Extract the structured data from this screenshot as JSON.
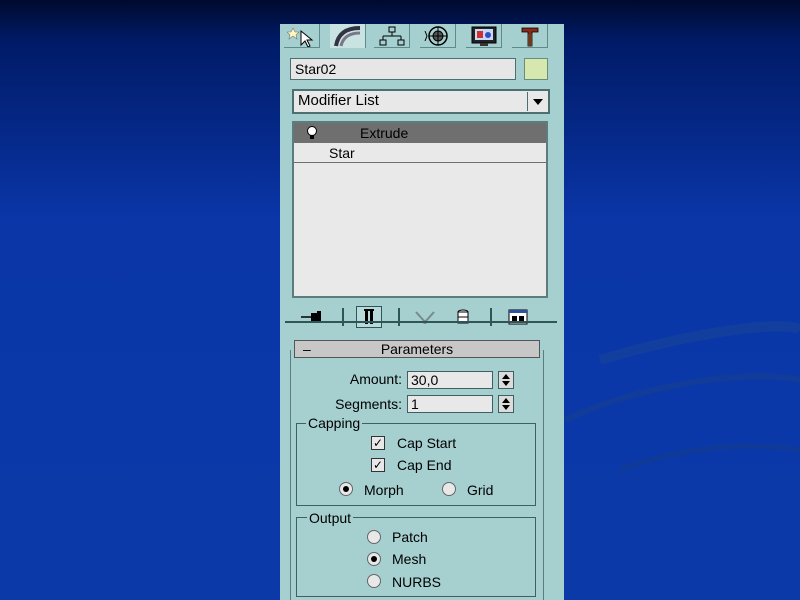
{
  "object_name": "Star02",
  "object_color": "#d6e8ad",
  "modifier_list": {
    "label": "Modifier List"
  },
  "tabs": [
    {
      "icon": "create-icon"
    },
    {
      "icon": "modify-icon"
    },
    {
      "icon": "hierarchy-icon"
    },
    {
      "icon": "motion-icon"
    },
    {
      "icon": "display-icon"
    },
    {
      "icon": "utilities-icon"
    }
  ],
  "stack": {
    "items": [
      {
        "label": "Extrude",
        "selected": true
      },
      {
        "label": "Star",
        "selected": false
      }
    ]
  },
  "stack_tools": [
    "pin-stack-icon",
    "show-end-result-icon",
    "make-unique-icon",
    "remove-modifier-icon",
    "configure-modifier-sets-icon"
  ],
  "parameters": {
    "title": "Parameters",
    "collapse": "–",
    "amount_label": "Amount:",
    "amount_value": "30,0",
    "segments_label": "Segments:",
    "segments_value": "1",
    "capping": {
      "label": "Capping",
      "cap_start": {
        "label": "Cap Start",
        "checked": true
      },
      "cap_end": {
        "label": "Cap End",
        "checked": true
      },
      "morph": {
        "label": "Morph",
        "selected": true
      },
      "grid": {
        "label": "Grid",
        "selected": false
      }
    },
    "output": {
      "label": "Output",
      "patch": {
        "label": "Patch",
        "selected": false
      },
      "mesh": {
        "label": "Mesh",
        "selected": true
      },
      "nurbs": {
        "label": "NURBS",
        "selected": false
      }
    }
  },
  "colors": {
    "panel": "#a6cfd0",
    "selected_row": "#6f6f6f",
    "background": "#0b3aa8"
  }
}
